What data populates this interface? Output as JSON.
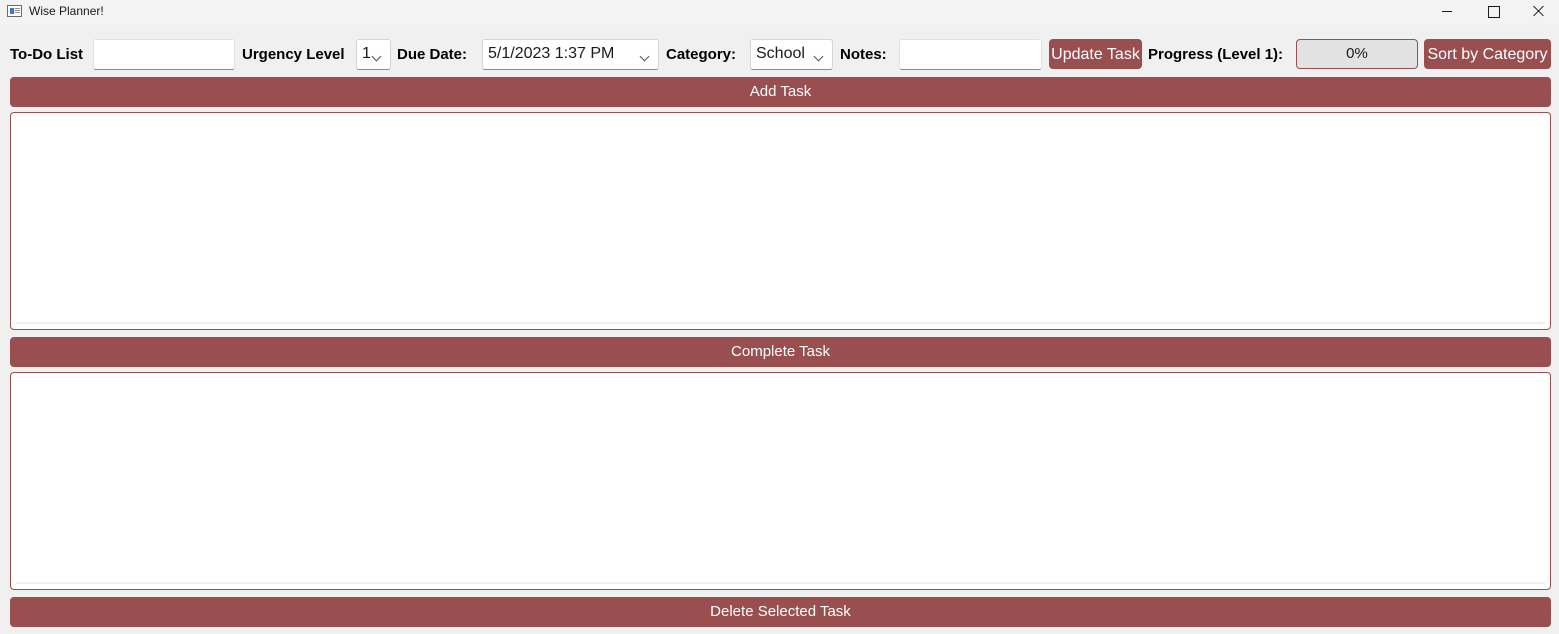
{
  "window": {
    "title": "Wise Planner!",
    "icon": "app-window-icon",
    "controls": [
      "minimize-icon",
      "maximize-icon",
      "close-icon"
    ]
  },
  "toolbar": {
    "todo_label": "To-Do List",
    "todo_value": "",
    "urgency_label": "Urgency Level",
    "urgency_value": "1",
    "due_label": "Due Date:",
    "due_value": "5/1/2023 1:37 PM",
    "category_label": "Category:",
    "category_value": "School",
    "notes_label": "Notes:",
    "notes_value": "",
    "update_label": "Update Task",
    "progress_label": "Progress (Level 1):",
    "progress_text": "0%",
    "progress_value": 0,
    "sort_label": "Sort by Category"
  },
  "actions": {
    "add_label": "Add Task",
    "complete_label": "Complete Task",
    "delete_label": "Delete Selected Task"
  },
  "lists": {
    "tasks": [],
    "completed": []
  },
  "colors": {
    "accent": "#994e50",
    "background": "#f0f0f0",
    "progress_track": "#e2e2e2"
  }
}
